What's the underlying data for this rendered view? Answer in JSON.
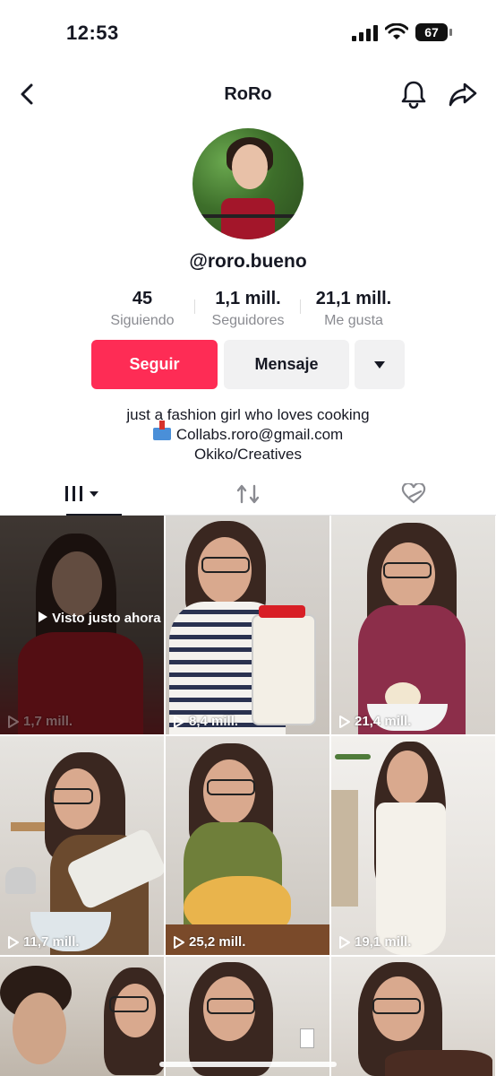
{
  "status_bar": {
    "time": "12:53",
    "battery": "67"
  },
  "nav": {
    "title": "RoRo"
  },
  "profile": {
    "handle": "@roro.bueno",
    "stats": [
      {
        "value": "45",
        "label": "Siguiendo"
      },
      {
        "value": "1,1 mill.",
        "label": "Seguidores"
      },
      {
        "value": "21,1 mill.",
        "label": "Me gusta"
      }
    ],
    "buttons": {
      "follow": "Seguir",
      "message": "Mensaje"
    },
    "bio": {
      "line1": "just a fashion girl who loves cooking",
      "line2": "Collabs.roro@gmail.com",
      "line3": "Okiko/Creatives"
    }
  },
  "tabs": [
    "videos-icon",
    "reposts-icon",
    "liked-icon"
  ],
  "videos": [
    {
      "views": "1,7 mill.",
      "seen_label": "Visto justo ahora"
    },
    {
      "views": "8,4 mill."
    },
    {
      "views": "21,4 mill."
    },
    {
      "views": "11,7 mill."
    },
    {
      "views": "25,2 mill."
    },
    {
      "views": "19,1 mill."
    },
    {
      "views": ""
    },
    {
      "views": ""
    },
    {
      "views": ""
    }
  ],
  "colors": {
    "accent": "#fe2c55",
    "secondary_button": "#f1f1f2"
  }
}
